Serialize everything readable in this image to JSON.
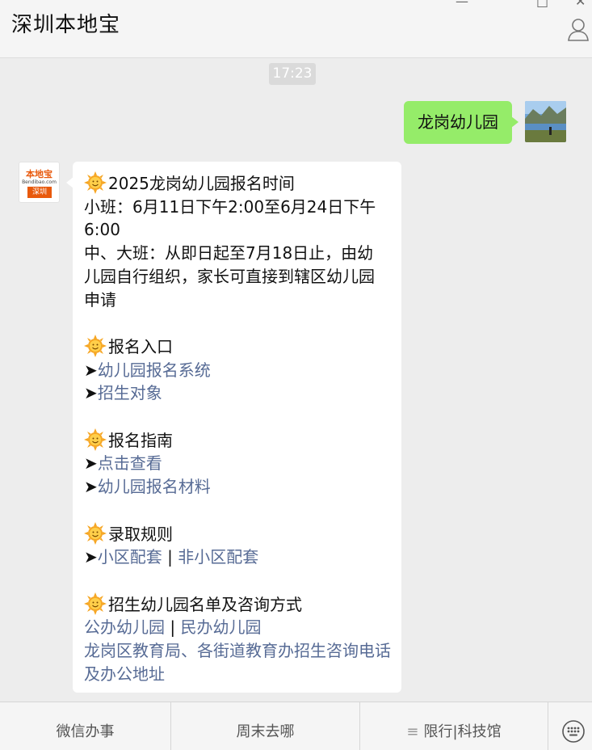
{
  "header": {
    "title": "深圳本地宝",
    "win_minimize": "—",
    "win_maximize": "□",
    "win_close": "✕"
  },
  "chat": {
    "timestamp": "17:23",
    "outgoing": {
      "text": "龙岗幼儿园"
    },
    "incoming": {
      "avatar_brand": "本地宝",
      "avatar_url": "Bendibao.com",
      "avatar_city": "深圳",
      "lines": {
        "s1_title": "2025龙岗幼儿园报名时间",
        "s1_p1a": "小班：6月11日下午2:00至6月24日下午",
        "s1_p1b": "6:00",
        "s1_p2a": "中、大班：从即日起至7月18日止，由幼",
        "s1_p2b": "儿园自行组织，家长可直接到辖区幼儿园",
        "s1_p2c": "申请",
        "s2_title": "报名入口",
        "s2_link1": "幼儿园报名系统",
        "s2_link2": "招生对象",
        "s3_title": "报名指南",
        "s3_link1": "点击查看",
        "s3_link2": "幼儿园报名材料",
        "s4_title": "录取规则",
        "s4_link1": "小区配套",
        "s4_link2": "非小区配套",
        "s5_title": "招生幼儿园名单及咨询方式",
        "s5_link1": "公办幼儿园",
        "s5_link2": "民办幼儿园",
        "s5_link3": "龙岗区教育局、各街道教育办招生咨询电话及办公地址",
        "arrow": "➤",
        "separator": " | "
      }
    }
  },
  "bottom_menu": {
    "items": [
      "微信办事",
      "周末去哪",
      "限行|科技馆"
    ]
  },
  "colors": {
    "outgoing_bubble": "#95ec69",
    "link": "#576b95",
    "brand": "#e8590c"
  }
}
